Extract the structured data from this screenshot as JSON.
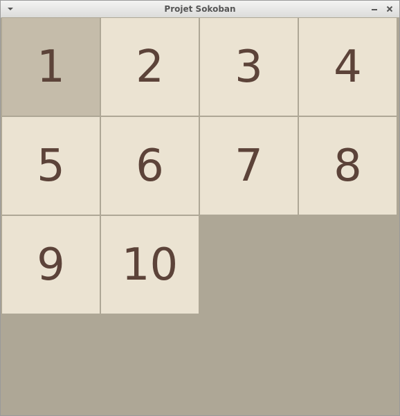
{
  "window": {
    "title": "Projet Sokoban",
    "menu_icon": "chevron-down-icon",
    "minimize_icon": "minimize-icon",
    "close_icon": "close-icon"
  },
  "board": {
    "columns": 4,
    "background_color": "#aea796",
    "tile_color": "#ebe3d2",
    "selected_tile_color": "#c5bcaa",
    "text_color": "#5c4339",
    "selected_level": "1",
    "levels": [
      "1",
      "2",
      "3",
      "4",
      "5",
      "6",
      "7",
      "8",
      "9",
      "10"
    ]
  }
}
